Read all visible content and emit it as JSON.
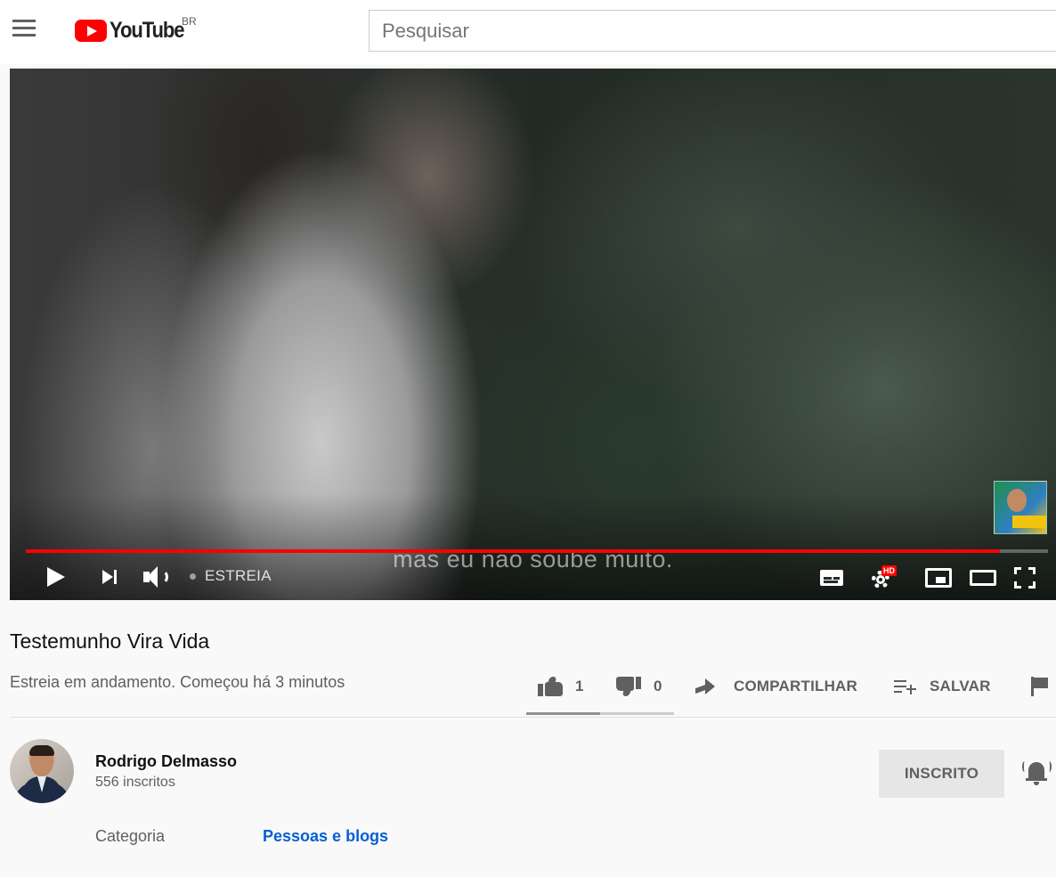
{
  "masthead": {
    "logo_text": "YouTube",
    "country_code": "BR",
    "search_placeholder": "Pesquisar"
  },
  "player": {
    "subtitle": "mas eu não soube muito.",
    "live_label": "ESTREIA",
    "progress": 0.953,
    "hd_badge": "HD"
  },
  "video": {
    "title": "Testemunho Vira Vida",
    "meta": "Estreia em andamento. Começou há 3 minutos"
  },
  "actions": {
    "likes": "1",
    "dislikes": "0",
    "share_label": "COMPARTILHAR",
    "save_label": "SALVAR",
    "like_ratio": 0.5
  },
  "owner": {
    "name": "Rodrigo Delmasso",
    "subscribers": "556 inscritos",
    "subscribe_label": "INSCRITO"
  },
  "metadata": {
    "category_label": "Categoria",
    "category_value": "Pessoas e blogs"
  },
  "colors": {
    "accent": "#ff0000",
    "link": "#065fd4",
    "secondary_text": "#606060"
  }
}
